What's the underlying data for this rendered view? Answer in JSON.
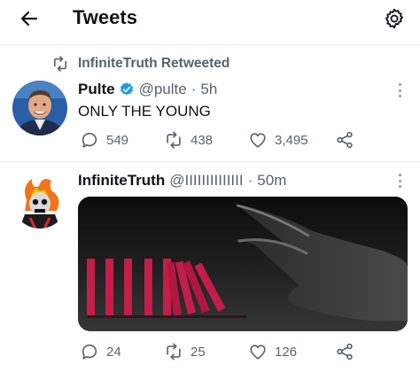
{
  "header": {
    "title": "Tweets"
  },
  "retweet_context": {
    "text": "InfiniteTruth Retweeted"
  },
  "tweets": [
    {
      "name": "Pulte",
      "verified": true,
      "handle": "@pulte",
      "time": "5h",
      "text": "ONLY THE YOUNG",
      "replies": "549",
      "retweets": "438",
      "likes": "3,495"
    },
    {
      "name": "InfiniteTruth",
      "verified": false,
      "handle": "@IIIIIIIIIIIIII",
      "time": "50m",
      "text": "",
      "replies": "24",
      "retweets": "25",
      "likes": "126"
    }
  ],
  "icons": {
    "back": "back-arrow-icon",
    "settings": "gear-icon",
    "retweet": "retweet-icon",
    "reply": "reply-icon",
    "like": "heart-icon",
    "share": "share-icon",
    "verified": "verified-badge-icon",
    "more": "more-vertical-icon"
  },
  "colors": {
    "accent": "#1d9bf0",
    "secondary_text": "#536471",
    "primary_text": "#0f1419"
  }
}
